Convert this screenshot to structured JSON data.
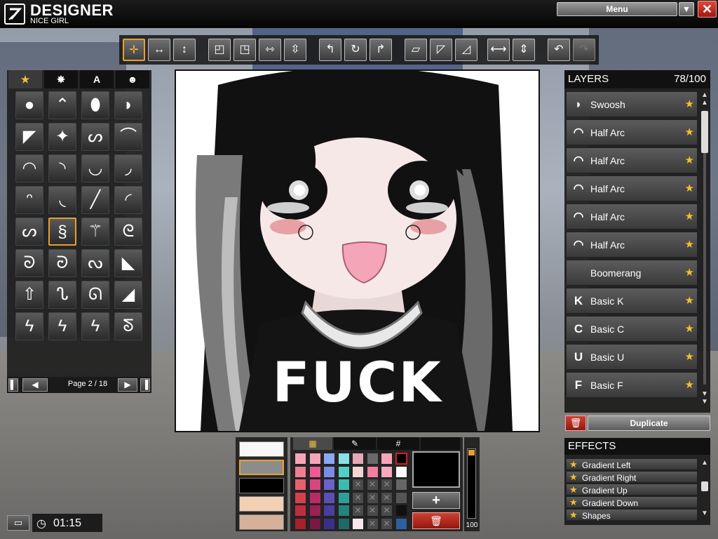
{
  "app": {
    "title": "DESIGNER",
    "subtitle": "NICE GIRL"
  },
  "window": {
    "menu_label": "Menu",
    "menu_dropdown": "chevron-down-icon",
    "close": "close-icon"
  },
  "toolbar": {
    "tools": [
      {
        "name": "move-tool",
        "icon": "✛"
      },
      {
        "name": "stretch-horizontal-tool",
        "icon": "↔"
      },
      {
        "name": "stretch-vertical-tool",
        "icon": "↕"
      },
      {
        "name": "align-top-left-tool",
        "icon": "◰"
      },
      {
        "name": "align-top-right-tool",
        "icon": "◳"
      },
      {
        "name": "fit-horizontal-tool",
        "icon": "⇿"
      },
      {
        "name": "fit-vertical-tool",
        "icon": "⇳"
      },
      {
        "name": "rotate-left-tool",
        "icon": "↰"
      },
      {
        "name": "rotate-tool",
        "icon": "↻"
      },
      {
        "name": "rotate-right-tool",
        "icon": "↱"
      },
      {
        "name": "skew-tool",
        "icon": "▱"
      },
      {
        "name": "skew-right-tool",
        "icon": "◸"
      },
      {
        "name": "skew-up-tool",
        "icon": "◿"
      },
      {
        "name": "flip-horizontal-tool",
        "icon": "⟷"
      },
      {
        "name": "flip-vertical-tool",
        "icon": "⇕"
      },
      {
        "name": "undo-button",
        "icon": "↶"
      },
      {
        "name": "redo-button",
        "icon": "↷"
      }
    ]
  },
  "shapes_panel": {
    "tabs": [
      {
        "name": "favorites-tab",
        "icon": "★"
      },
      {
        "name": "splat-tab",
        "icon": "✸"
      },
      {
        "name": "text-tab",
        "icon": "A"
      },
      {
        "name": "people-tab",
        "icon": "☻"
      }
    ],
    "shapes": [
      "●",
      "⌃",
      "⬮",
      "◗",
      "◤",
      "✦",
      "ᔕ",
      "⌒",
      "◠",
      "◝",
      "◡",
      "◞",
      "ᵔ",
      "◟",
      "╱",
      "◜",
      "ᔕ",
      "§",
      "⚚",
      "ᘓ",
      "ᘐ",
      "ᘒ",
      "ᔓ",
      "◣",
      "⇧",
      "ᔐ",
      "ᘏ",
      "◢",
      "ϟ",
      "ϟ",
      "ϟ",
      "ᘕ"
    ],
    "page_label": "Page 2 / 18"
  },
  "canvas": {
    "text": "FUCK"
  },
  "layers": {
    "title": "LAYERS",
    "count": "78/100",
    "items": [
      {
        "name": "Swoosh",
        "icon": "◗"
      },
      {
        "name": "Half Arc",
        "icon": "◠"
      },
      {
        "name": "Half Arc",
        "icon": "◠"
      },
      {
        "name": "Half Arc",
        "icon": "◠"
      },
      {
        "name": "Half Arc",
        "icon": "◠"
      },
      {
        "name": "Half Arc",
        "icon": "◠"
      },
      {
        "name": "Boomerang",
        "icon": ""
      },
      {
        "name": "Basic K",
        "icon": "K"
      },
      {
        "name": "Basic C",
        "icon": "C"
      },
      {
        "name": "Basic U",
        "icon": "U"
      },
      {
        "name": "Basic F",
        "icon": "F"
      }
    ],
    "duplicate_label": "Duplicate"
  },
  "effects": {
    "title": "EFFECTS",
    "items": [
      "Gradient Left",
      "Gradient Right",
      "Gradient Up",
      "Gradient Down",
      "Shapes"
    ]
  },
  "colors": {
    "swatches": [
      "#f7f7f7",
      "#8c8c8c",
      "#000000",
      "#f3cfb3",
      "#d7b09a"
    ],
    "palette": [
      [
        "#f4a6b8",
        "#f4a6b8",
        "#8aa8ef",
        "#8ae0e8",
        "#e4a8b8",
        "#6a6a6a",
        "#f4a6b8",
        "#000000"
      ],
      [
        "#ef7d95",
        "#ec5c93",
        "#7b8ce6",
        "#50d0c8",
        "#f5d4d4",
        "#f07fa0",
        "#f8a8c0",
        "#ffffff"
      ],
      [
        "#e8606d",
        "#d9457f",
        "#6b62c8",
        "#3cbcb0",
        "x",
        "x",
        "x",
        "#666666"
      ],
      [
        "#d6404d",
        "#b92b66",
        "#5a4fb4",
        "#2e9f98",
        "x",
        "x",
        "x",
        "#555555"
      ],
      [
        "#bf2e3e",
        "#9c2055",
        "#4a3ea0",
        "#25847f",
        "x",
        "x",
        "x",
        "#111111"
      ],
      [
        "#a81f2e",
        "#7a1845",
        "#3a308a",
        "#1e6a6a",
        "#f5e8ea",
        "x",
        "x",
        "#2f5fa0"
      ]
    ],
    "tabs": [
      "palette-tab",
      "eyedropper-tab",
      "hex-tab"
    ],
    "opacity": "100"
  },
  "status": {
    "time": "01:15"
  }
}
